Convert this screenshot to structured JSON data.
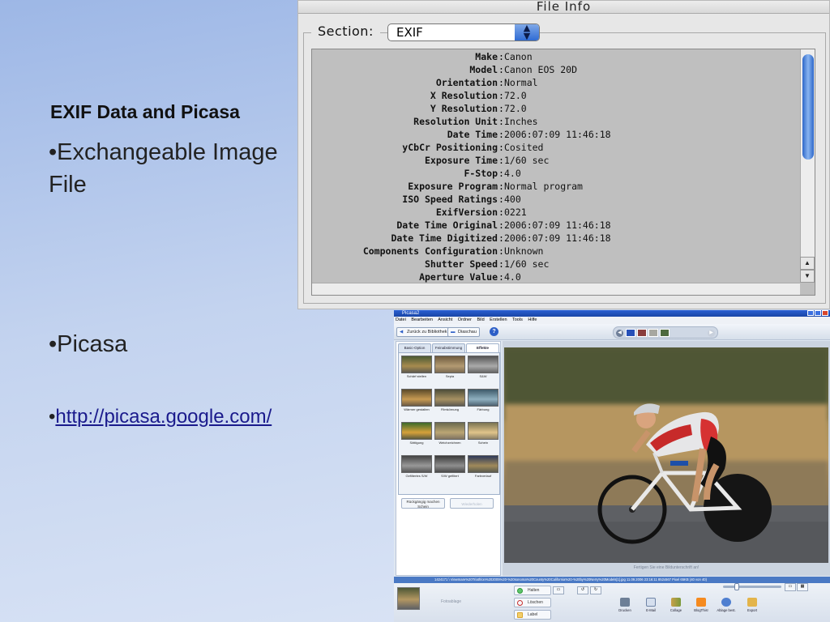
{
  "slide": {
    "title": "EXIF Data and Picasa",
    "bullet1": "•Exchangeable Image File",
    "bullet2": "•Picasa",
    "bullet3_prefix": "•",
    "bullet3_link": "http://picasa.google.com/"
  },
  "file_info": {
    "window_title": "File Info",
    "section_label": "Section:",
    "section_value": "EXIF",
    "rows": [
      {
        "key": "Make",
        "value": "Canon"
      },
      {
        "key": "Model",
        "value": "Canon EOS 20D"
      },
      {
        "key": "Orientation",
        "value": "Normal"
      },
      {
        "key": "X Resolution",
        "value": "72.0"
      },
      {
        "key": "Y Resolution",
        "value": "72.0"
      },
      {
        "key": "Resolution Unit",
        "value": "Inches"
      },
      {
        "key": "Date Time",
        "value": "2006:07:09 11:46:18"
      },
      {
        "key": "yCbCr Positioning",
        "value": "Cosited"
      },
      {
        "key": "Exposure Time",
        "value": "1/60 sec"
      },
      {
        "key": "F-Stop",
        "value": "4.0"
      },
      {
        "key": "Exposure Program",
        "value": "Normal program"
      },
      {
        "key": "ISO Speed Ratings",
        "value": "400"
      },
      {
        "key": "ExifVersion",
        "value": "0221"
      },
      {
        "key": "Date Time Original",
        "value": "2006:07:09 11:46:18"
      },
      {
        "key": "Date Time Digitized",
        "value": "2006:07:09 11:46:18"
      },
      {
        "key": "Components Configuration",
        "value": "Unknown"
      },
      {
        "key": "Shutter Speed",
        "value": "1/60 sec"
      },
      {
        "key": "Aperture Value",
        "value": "4.0"
      }
    ]
  },
  "picasa": {
    "window_title": "Picasa2",
    "menu": [
      "Datei",
      "Bearbeiten",
      "Ansicht",
      "Ordner",
      "Bild",
      "Erstellen",
      "Tools",
      "Hilfe"
    ],
    "toolbar": {
      "back_label": "Zurück zu Bibliothek",
      "slideshow_label": "Diaschau",
      "help_label": "?"
    },
    "tabs": [
      "Basic-Option",
      "Feinabstimmung",
      "Effekte"
    ],
    "effects": [
      "Schärf stellen",
      "Sepia",
      "S&W",
      "Wärmer gestalten",
      "Filmkörnung",
      "Färbung",
      "Sättigung",
      "Weichzeichnen",
      "Schein",
      "Gefiltertes S/W",
      "S/W gefiltert",
      "Farbverlauf"
    ],
    "undo_label": "Rückgängig machen Schein",
    "redo_label": "Wiederholen",
    "caption_placeholder": "Fertigen Sie eine Bildunterschrift an!",
    "status_text": "1424171 \\ Viewmare%20Triathlon%202005%20-%20sonoma%20County%20California%20-%20by%20Nerry%20Models[1].jpg    11.09.2006 23:16:11    852x567 Pixel    65KB    (40 von 40)",
    "tray_label": "Fotoablage",
    "side_buttons": [
      "Halten",
      "Löschen",
      "Label"
    ],
    "actions": [
      "Drucken",
      "E-Mail",
      "Collage",
      "BlogThis!",
      "Ablage best.",
      "Export"
    ]
  },
  "colors": {
    "accent": "#2f6bd4",
    "picasa_titlebar": "#2a5fd2",
    "link": "#1a1a8c"
  }
}
